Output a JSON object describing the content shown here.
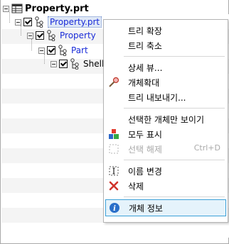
{
  "tree": {
    "root": {
      "label": "Property.prt"
    },
    "nodes": [
      {
        "label": "Property.prt",
        "checked": true,
        "selected": true
      },
      {
        "label": "Property",
        "checked": true
      },
      {
        "label": "Part",
        "checked": true
      },
      {
        "label": "Shell",
        "checked": true
      }
    ]
  },
  "context_menu": {
    "items": [
      {
        "label": "트리 확장"
      },
      {
        "label": "트리 축소"
      },
      {
        "label": "상세 뷰..."
      },
      {
        "label": "개체확대",
        "icon": "magnify-pin-icon"
      },
      {
        "label": "트리 내보내기..."
      },
      {
        "label": "선택한 개체만 보이기"
      },
      {
        "label": "모두 표시",
        "icon": "shapes-icon"
      },
      {
        "label": "선택 해제",
        "shortcut": "Ctrl+D",
        "disabled": true,
        "icon": "dashed-box-icon"
      },
      {
        "label": "이름 변경",
        "icon": "rename-icon"
      },
      {
        "label": "삭제",
        "icon": "delete-x-icon"
      },
      {
        "label": "개체 정보",
        "icon": "info-icon",
        "highlighted": true
      }
    ]
  },
  "colors": {
    "link_blue": "#1a2cd8",
    "highlight_border": "#3ba0d8",
    "delete_red": "#d0342c",
    "info_blue": "#2a6fc9"
  }
}
